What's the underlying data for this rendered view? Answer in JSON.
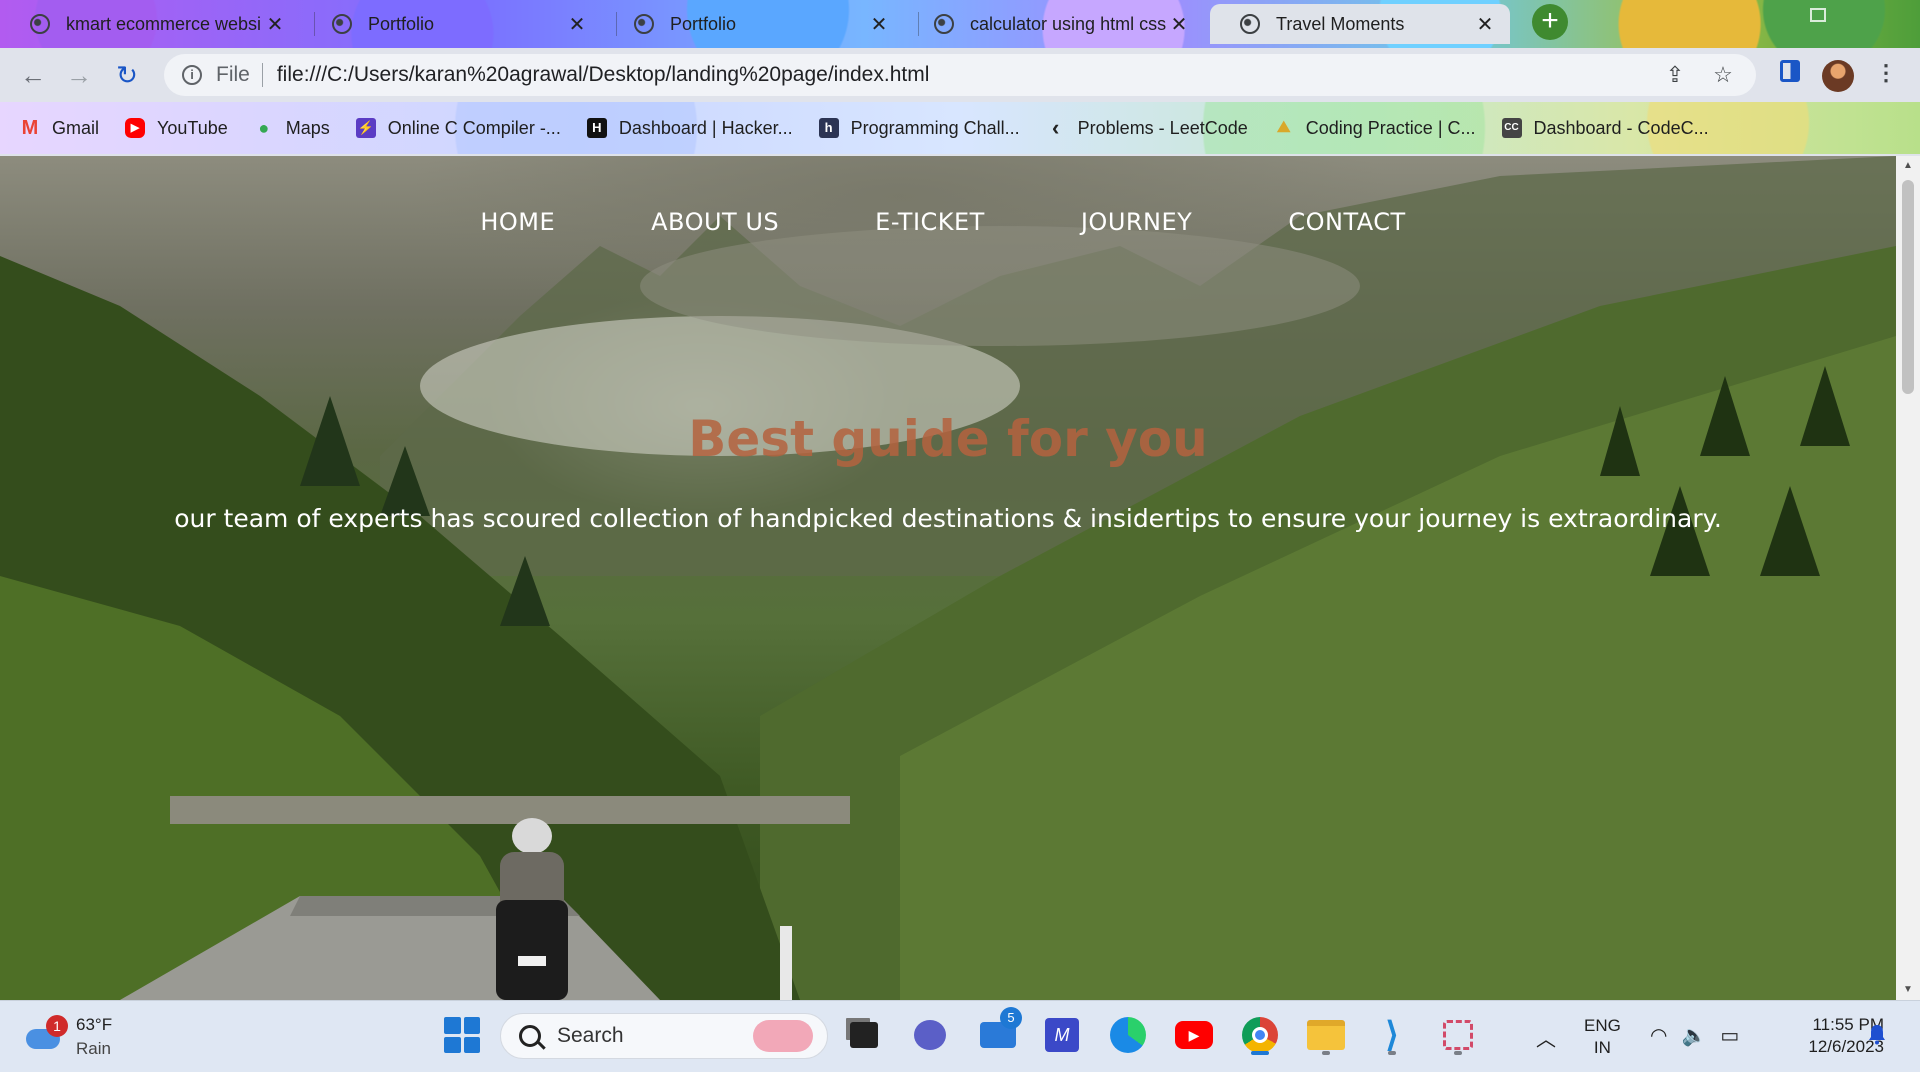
{
  "browser": {
    "tabs": [
      {
        "title": "kmart ecommerce websi",
        "active": false
      },
      {
        "title": "Portfolio",
        "active": false
      },
      {
        "title": "Portfolio",
        "active": false
      },
      {
        "title": "calculator using html css",
        "active": false
      },
      {
        "title": "Travel Moments",
        "active": true
      }
    ],
    "tab_close_glyph": "✕",
    "new_tab_glyph": "+",
    "omnibox": {
      "scheme": "File",
      "url": "file:///C:/Users/karan%20agrawal/Desktop/landing%20page/index.html"
    },
    "bookmarks": [
      {
        "label": "Gmail",
        "icon": "gmail-icon",
        "color": "#ea4335",
        "glyph": "M"
      },
      {
        "label": "YouTube",
        "icon": "youtube-icon",
        "color": "#ff0000",
        "glyph": "▶"
      },
      {
        "label": "Maps",
        "icon": "maps-icon",
        "color": "#34a853",
        "glyph": "●"
      },
      {
        "label": "Online C Compiler -...",
        "icon": "compiler-icon",
        "color": "#5b3cc4",
        "glyph": "⚡"
      },
      {
        "label": "Dashboard | Hacker...",
        "icon": "hackerrank-icon",
        "color": "#111111",
        "glyph": "H"
      },
      {
        "label": "Programming Chall...",
        "icon": "hackerearth-icon",
        "color": "#2c3454",
        "glyph": "h"
      },
      {
        "label": "Problems - LeetCode",
        "icon": "leetcode-icon",
        "color": "#f5f5f5",
        "glyph": "‹"
      },
      {
        "label": "Coding Practice | C...",
        "icon": "practice-icon",
        "color": "#f2c14e",
        "glyph": "⛰"
      },
      {
        "label": "Dashboard - CodeC...",
        "icon": "codechef-icon",
        "color": "#444444",
        "glyph": "CC"
      }
    ]
  },
  "site": {
    "nav": [
      "HOME",
      "ABOUT US",
      "E-TICKET",
      "JOURNEY",
      "CONTACT"
    ],
    "hero_title": "Best guide for you",
    "hero_text": "our team of experts has scoured collection of handpicked destinations & insidertips to ensure your journey is extraordinary.",
    "title_color": "#b4633f"
  },
  "taskbar": {
    "weather": {
      "temp": "63°F",
      "condition": "Rain",
      "alert_count": "1"
    },
    "search_label": "Search",
    "mail_badge": "5",
    "language": {
      "line1": "ENG",
      "line2": "IN"
    },
    "time": "11:55 PM",
    "date": "12/6/2023"
  }
}
